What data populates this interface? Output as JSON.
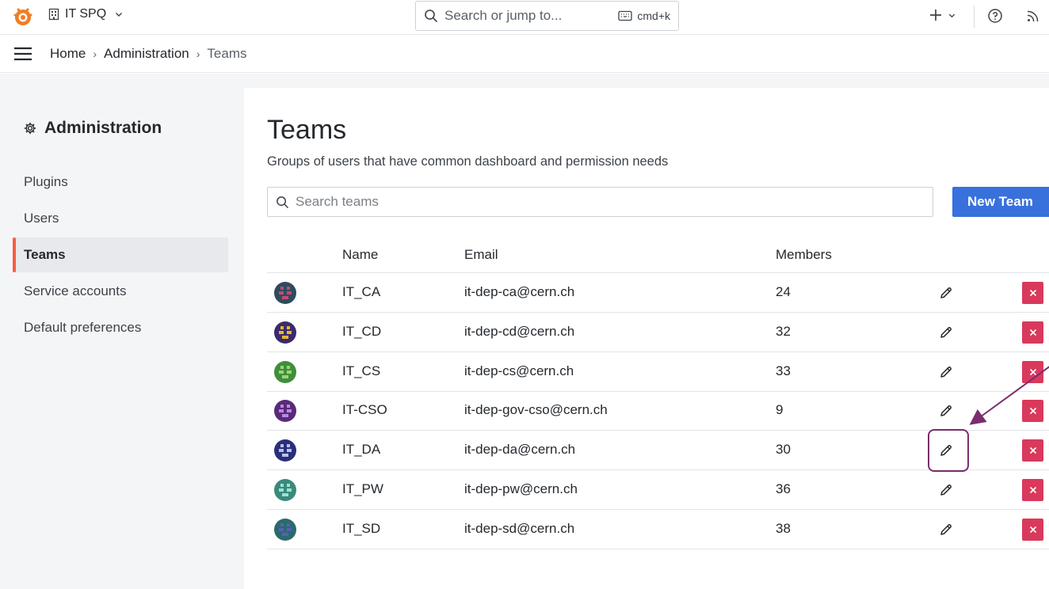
{
  "topbar": {
    "org_name": "IT SPQ",
    "search_placeholder": "Search or jump to...",
    "shortcut": "cmd+k"
  },
  "breadcrumb": {
    "items": [
      "Home",
      "Administration",
      "Teams"
    ]
  },
  "sidebar": {
    "title": "Administration",
    "items": [
      {
        "label": "Plugins",
        "active": false
      },
      {
        "label": "Users",
        "active": false
      },
      {
        "label": "Teams",
        "active": true
      },
      {
        "label": "Service accounts",
        "active": false
      },
      {
        "label": "Default preferences",
        "active": false
      }
    ]
  },
  "main": {
    "title": "Teams",
    "subtitle": "Groups of users that have common dashboard and permission needs",
    "search_placeholder": "Search teams",
    "new_button": "New Team",
    "columns": [
      "Name",
      "Email",
      "Members"
    ],
    "rows": [
      {
        "name": "IT_CA",
        "email": "it-dep-ca@cern.ch",
        "members": "24",
        "avatar_color": "#2f4b5e",
        "avatar_accent": "#c64a6e"
      },
      {
        "name": "IT_CD",
        "email": "it-dep-cd@cern.ch",
        "members": "32",
        "avatar_color": "#3a2a6e",
        "avatar_accent": "#e8b52a"
      },
      {
        "name": "IT_CS",
        "email": "it-dep-cs@cern.ch",
        "members": "33",
        "avatar_color": "#3f8f3a",
        "avatar_accent": "#9fd27a"
      },
      {
        "name": "IT-CSO",
        "email": "it-dep-gov-cso@cern.ch",
        "members": "9",
        "avatar_color": "#5a2a7a",
        "avatar_accent": "#b88ae0"
      },
      {
        "name": "IT_DA",
        "email": "it-dep-da@cern.ch",
        "members": "30",
        "avatar_color": "#2a2f7a",
        "avatar_accent": "#b7c3e8"
      },
      {
        "name": "IT_PW",
        "email": "it-dep-pw@cern.ch",
        "members": "36",
        "avatar_color": "#3a8a7a",
        "avatar_accent": "#9ee0d8"
      },
      {
        "name": "IT_SD",
        "email": "it-dep-sd@cern.ch",
        "members": "38",
        "avatar_color": "#2a6a6e",
        "avatar_accent": "#5a5fb8"
      }
    ]
  },
  "colors": {
    "primary": "#3871dc",
    "danger": "#d9395c",
    "active_indicator": "#f55f3e",
    "annotation": "#7a2e6e"
  }
}
